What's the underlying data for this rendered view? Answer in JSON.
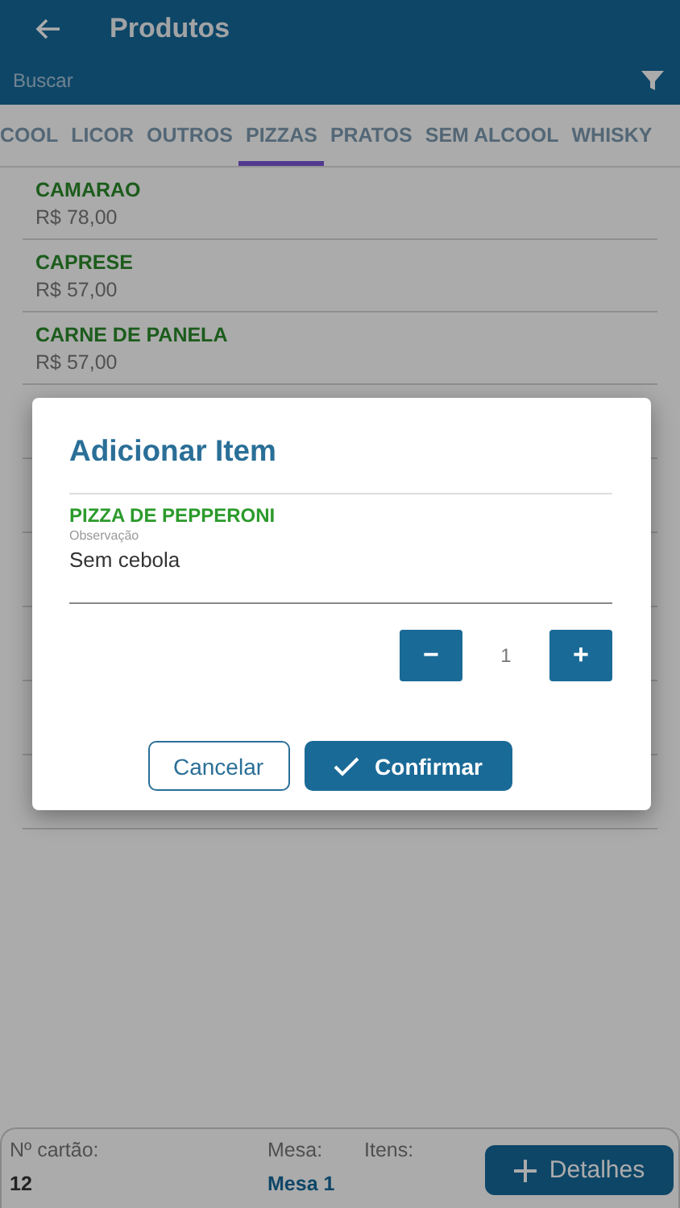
{
  "header": {
    "title": "Produtos",
    "search": {
      "placeholder": "Buscar"
    }
  },
  "tabs": [
    {
      "label": "COOL",
      "selected": false
    },
    {
      "label": "LICOR",
      "selected": false
    },
    {
      "label": "OUTROS",
      "selected": false
    },
    {
      "label": "PIZZAS",
      "selected": true
    },
    {
      "label": "PRATOS",
      "selected": false
    },
    {
      "label": "SEM ALCOOL",
      "selected": false
    },
    {
      "label": "WHISKY",
      "selected": false
    }
  ],
  "products": [
    {
      "name": "CAMARAO",
      "price": "R$ 78,00"
    },
    {
      "name": "CAPRESE",
      "price": "R$ 57,00"
    },
    {
      "name": "CARNE DE PANELA",
      "price": "R$ 57,00"
    }
  ],
  "footer": {
    "card_label": "Nº cartão:",
    "card": "12",
    "table_label": "Mesa:",
    "table": "Mesa 1",
    "items_label": "Itens:",
    "details_button": "Detalhes"
  },
  "dialog": {
    "title": "Adicionar Item",
    "product": "PIZZA DE PEPPERONI",
    "note_label": "Observação",
    "note": "Sem cebola",
    "quantity": "1",
    "minus": "−",
    "plus": "+",
    "cancel": "Cancelar",
    "confirm": "Confirmar"
  }
}
